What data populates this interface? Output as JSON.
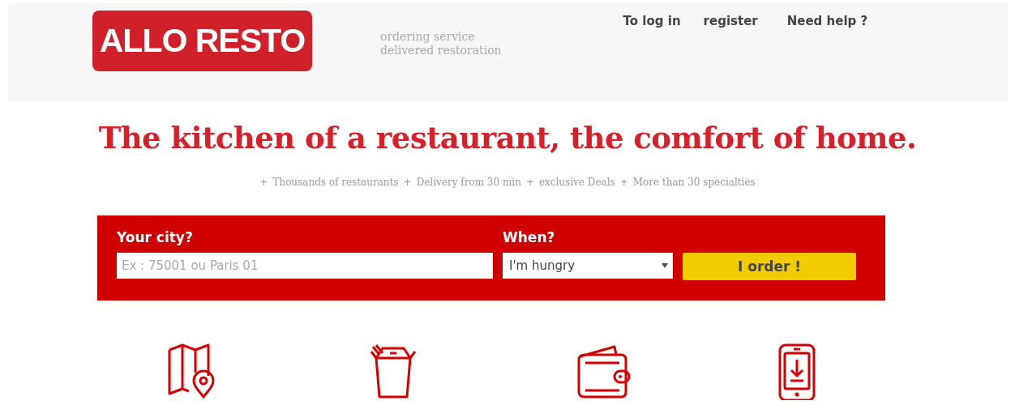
{
  "header": {
    "logo": "ALLO RESTO",
    "tagline": [
      "ordering service",
      "delivered restoration"
    ],
    "nav": [
      "To log in",
      "register",
      "Need help ?"
    ]
  },
  "headline": "The kitchen of a restaurant, the comfort of home.",
  "features": [
    {
      "marker": "+",
      "label": "Thousands of restaurants"
    },
    {
      "marker": "+",
      "label": "Delivery from 30 min"
    },
    {
      "marker": "+",
      "label": "exclusive Deals"
    },
    {
      "marker": "+",
      "label": "More than 30 specialties"
    }
  ],
  "order_form": {
    "city_label": "Your city?",
    "city_placeholder": "Ex : 75001 ou Paris 01",
    "when_label": "When?",
    "when_value": "I'm hungry",
    "submit": "I order !"
  },
  "icons": [
    {
      "kind": "map"
    },
    {
      "kind": "takeout"
    },
    {
      "kind": "wallet"
    },
    {
      "kind": "phone"
    }
  ]
}
